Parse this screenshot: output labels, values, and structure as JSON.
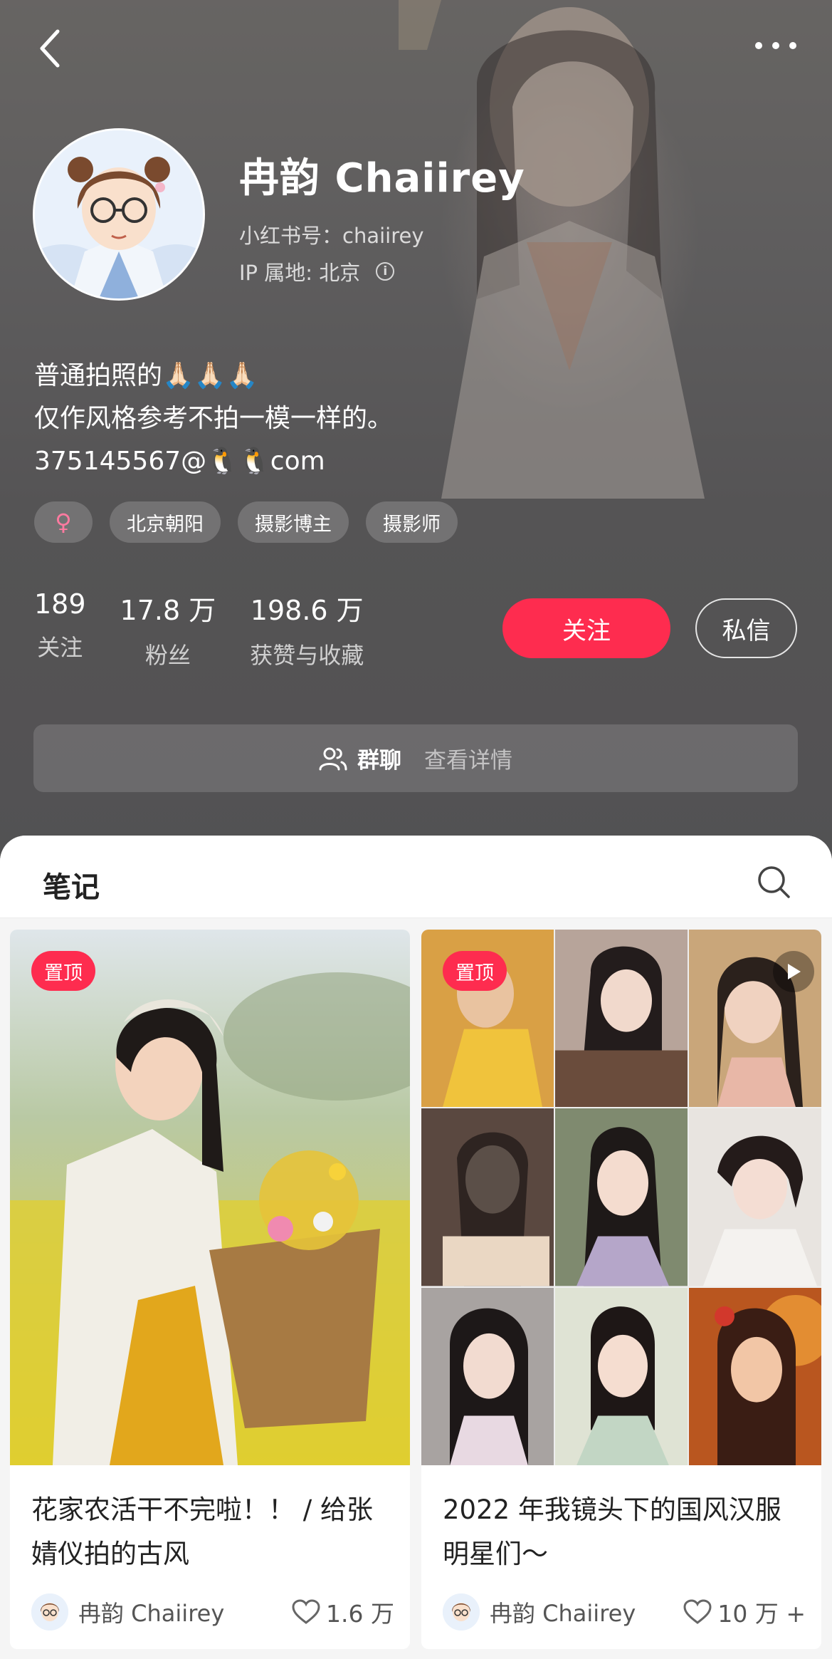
{
  "header": {
    "back_icon": "chevron-left-icon",
    "more_icon": "more-horizontal-icon"
  },
  "profile": {
    "name": "冉韵 Chaiirey",
    "red_id": "小红书号：chaiirey",
    "ip_location": "IP 属地: 北京",
    "bio_line1": "普通拍照的",
    "bio_line1_emoji": "🙏🏻🙏🏻🙏🏻",
    "bio_line2": "仅作风格参考不拍一模一样的。",
    "bio_line3_prefix": "375145567@",
    "bio_line3_emoji": "🐧🐧",
    "bio_line3_suffix": "com",
    "tags": {
      "gender": "♀",
      "tag1": "北京朝阳",
      "tag2": "摄影博主",
      "tag3": "摄影师"
    },
    "stats": {
      "following_num": "189",
      "following_label": "关注",
      "fans_num": "17.8 万",
      "fans_label": "粉丝",
      "likes_num": "198.6 万",
      "likes_label": "获赞与收藏"
    },
    "follow_label": "关注",
    "message_label": "私信",
    "group_label": "群聊",
    "group_detail": "查看详情"
  },
  "notes": {
    "tab_title": "笔记",
    "cards": [
      {
        "badge": "置顶",
        "title": "花家农活干不完啦！！ / 给张婧仪拍的古风",
        "author": "冉韵 Chaiirey",
        "likes": "1.6 万"
      },
      {
        "badge": "置顶",
        "title": "2022 年我镜头下的国风汉服明星们～",
        "author": "冉韵 Chaiirey",
        "likes": "10 万 +"
      }
    ]
  },
  "colors": {
    "accent": "#fe2c4f",
    "header_bg": "#5f5e60",
    "sheet_bg": "#f5f5f5"
  }
}
